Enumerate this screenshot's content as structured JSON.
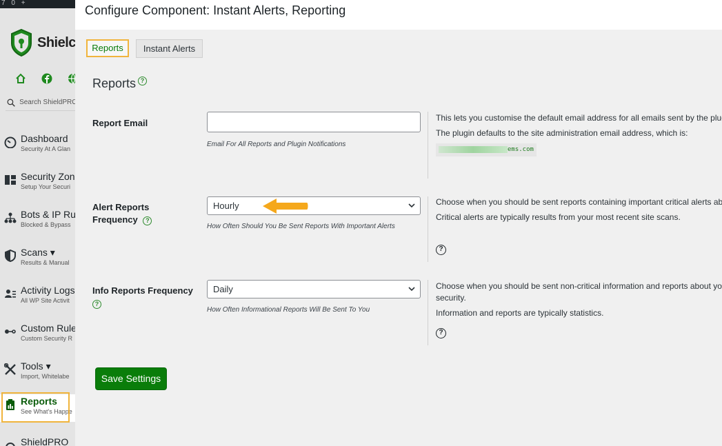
{
  "adminbar": {
    "items": [
      "7",
      "0",
      "+"
    ]
  },
  "sidebar": {
    "brand": "Shielc",
    "search_placeholder": "Search ShieldPRO",
    "items": [
      {
        "label": "Dashboard",
        "sub": "Security At A Glan"
      },
      {
        "label": "Security Zone",
        "sub": "Setup Your Securi"
      },
      {
        "label": "Bots & IP Ru",
        "sub": "Blocked & Bypass"
      },
      {
        "label": "Scans ▾",
        "sub": "Results & Manual"
      },
      {
        "label": "Activity Logs",
        "sub": "All WP Site Activit"
      },
      {
        "label": "Custom Rule",
        "sub": "Custom Security R"
      },
      {
        "label": "Tools ▾",
        "sub": "Import, Whitelabe"
      },
      {
        "label": "Reports",
        "sub": "See What's Happe"
      },
      {
        "label": "ShieldPRO",
        "sub": ""
      }
    ]
  },
  "modal": {
    "title": "Configure Component: Instant Alerts, Reporting",
    "tabs": [
      {
        "label": "Reports"
      },
      {
        "label": "Instant Alerts"
      }
    ],
    "section_title": "Reports",
    "help_glyph": "?",
    "fields": [
      {
        "label": "Report Email",
        "value": "",
        "note": "Email For All Reports and Plugin Notifications",
        "desc": [
          "This lets you customise the default email address for all emails sent by the plugi",
          "The plugin defaults to the site administration email address, which is:"
        ],
        "email_visible": "ems.com"
      },
      {
        "label": "Alert Reports Frequency",
        "value": "Hourly",
        "note": "How Often Should You Be Sent Reports With Important Alerts",
        "desc": [
          "Choose when you should be sent reports containing important critical alerts ab",
          "Critical alerts are typically results from your most recent site scans."
        ]
      },
      {
        "label": "Info Reports Frequency",
        "value": "Daily",
        "note": "How Often Informational Reports Will Be Sent To You",
        "desc": [
          "Choose when you should be sent non-critical information and reports about yo security.",
          "Information and reports are typically statistics."
        ]
      }
    ],
    "save_label": "Save Settings"
  },
  "colors": {
    "accent": "#0a7d0a",
    "highlight": "#f0b43c",
    "arrow": "#f5a81c"
  }
}
